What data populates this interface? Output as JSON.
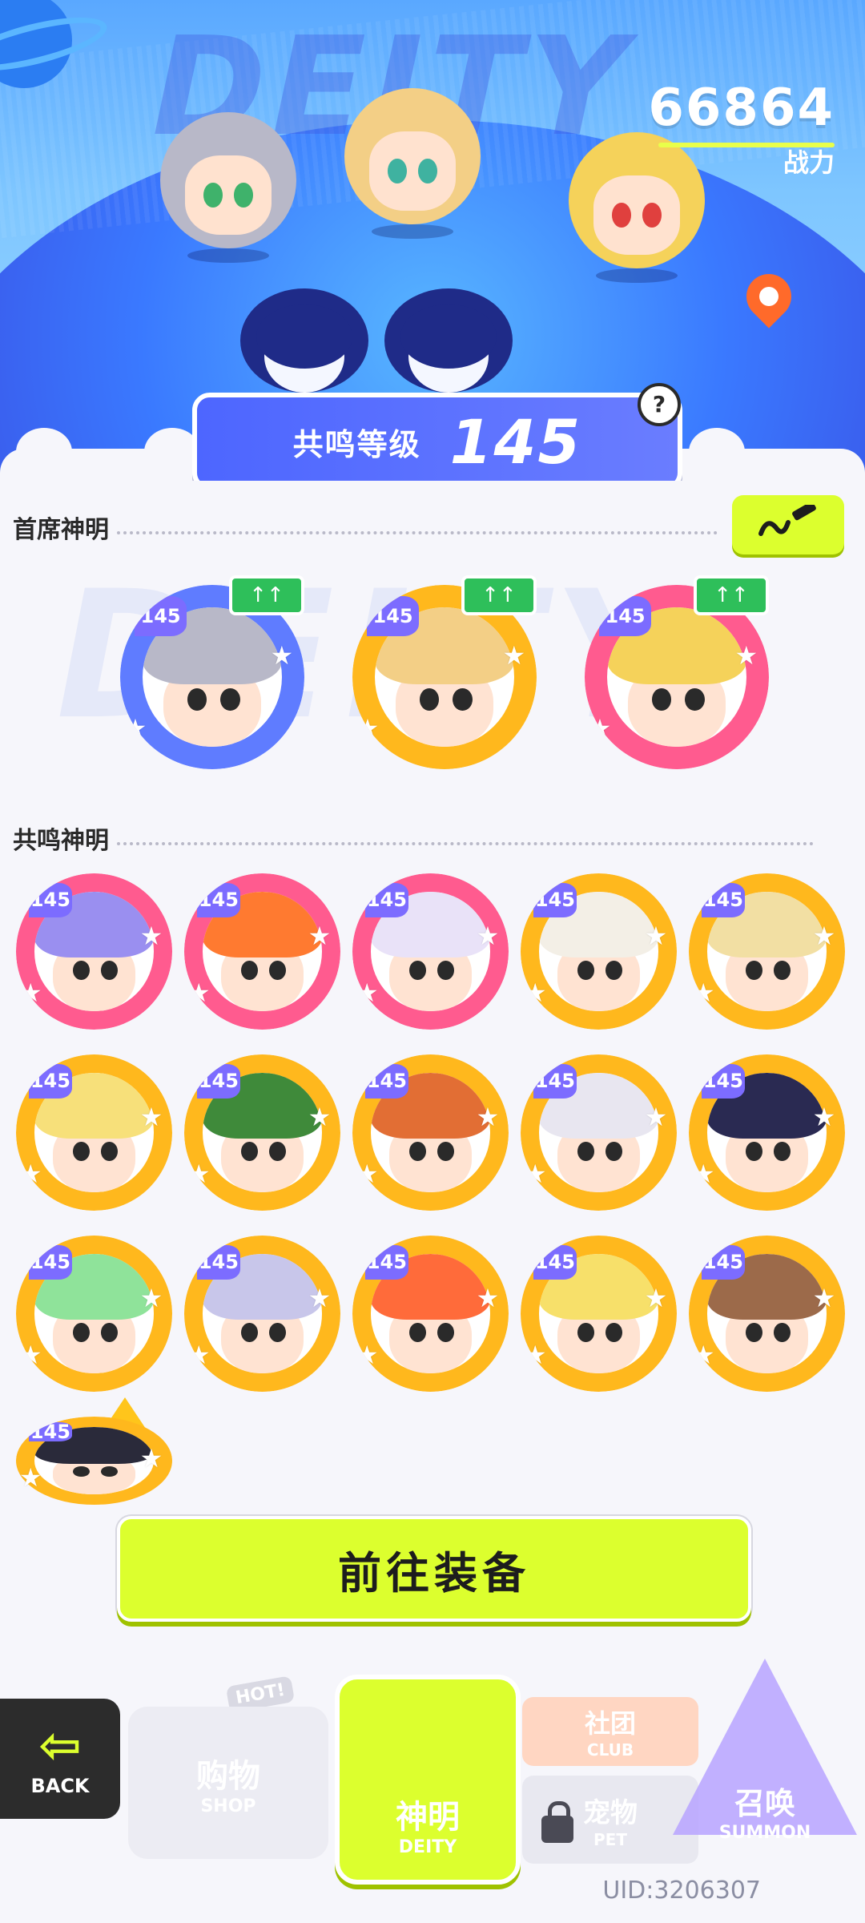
{
  "header": {
    "bg_word": "DEITY",
    "power_value": "66864",
    "power_label": "战力",
    "resonance_label": "共鸣等级",
    "resonance_level": "145",
    "help_icon": "?"
  },
  "sections": {
    "chief": "首席神明",
    "resonance": "共鸣神明"
  },
  "chief_badges": [
    {
      "level": "145",
      "ring_color": "#5f7cff",
      "hair_color": "#b8b8c8",
      "eye_color": "#3fb26b"
    },
    {
      "level": "145",
      "ring_color": "#ffb81d",
      "hair_color": "#f3cf86",
      "eye_color": "#3fb2a0"
    },
    {
      "level": "145",
      "ring_color": "#ff5b8f",
      "hair_color": "#f5d25a",
      "eye_color": "#e0403e"
    }
  ],
  "resonance_badges": [
    {
      "level": "145",
      "ring_color": "#ff5b8f",
      "hair_color": "#9a8ff0"
    },
    {
      "level": "145",
      "ring_color": "#ff5b8f",
      "hair_color": "#ff7a30"
    },
    {
      "level": "145",
      "ring_color": "#ff5b8f",
      "hair_color": "#e9e2f8"
    },
    {
      "level": "145",
      "ring_color": "#ffb81d",
      "hair_color": "#f3efe6"
    },
    {
      "level": "145",
      "ring_color": "#ffb81d",
      "hair_color": "#f2dfa3"
    },
    {
      "level": "145",
      "ring_color": "#ffb81d",
      "hair_color": "#f7e07a"
    },
    {
      "level": "145",
      "ring_color": "#ffb81d",
      "hair_color": "#3f8a3a"
    },
    {
      "level": "145",
      "ring_color": "#ffb81d",
      "hair_color": "#e26e34"
    },
    {
      "level": "145",
      "ring_color": "#ffb81d",
      "hair_color": "#e8e6f0"
    },
    {
      "level": "145",
      "ring_color": "#ffb81d",
      "hair_color": "#2a2a52"
    },
    {
      "level": "145",
      "ring_color": "#ffb81d",
      "hair_color": "#8fe39a"
    },
    {
      "level": "145",
      "ring_color": "#ffb81d",
      "hair_color": "#c8c6ea"
    },
    {
      "level": "145",
      "ring_color": "#ffb81d",
      "hair_color": "#ff6b3a"
    },
    {
      "level": "145",
      "ring_color": "#ffb81d",
      "hair_color": "#f7e06a"
    },
    {
      "level": "145",
      "ring_color": "#ffb81d",
      "hair_color": "#9c6a4a"
    },
    {
      "level": "145",
      "ring_color": "#ffb81d",
      "hair_color": "#2a2a3a"
    }
  ],
  "equip_button": "前往装备",
  "nav": {
    "back": "BACK",
    "hot": "HOT!",
    "shop_cn": "购物",
    "shop_en": "SHOP",
    "deity_cn": "神明",
    "deity_en": "DEITY",
    "club_cn": "社团",
    "club_en": "CLUB",
    "pet_cn": "宠物",
    "pet_en": "PET",
    "summon_cn": "召唤",
    "summon_en": "SUMMON"
  },
  "uid": "UID:3206307",
  "colors": {
    "accent": "#dcff2e",
    "upgrade_green": "#2ebf5a",
    "banner_blue": "#5a6bff"
  }
}
